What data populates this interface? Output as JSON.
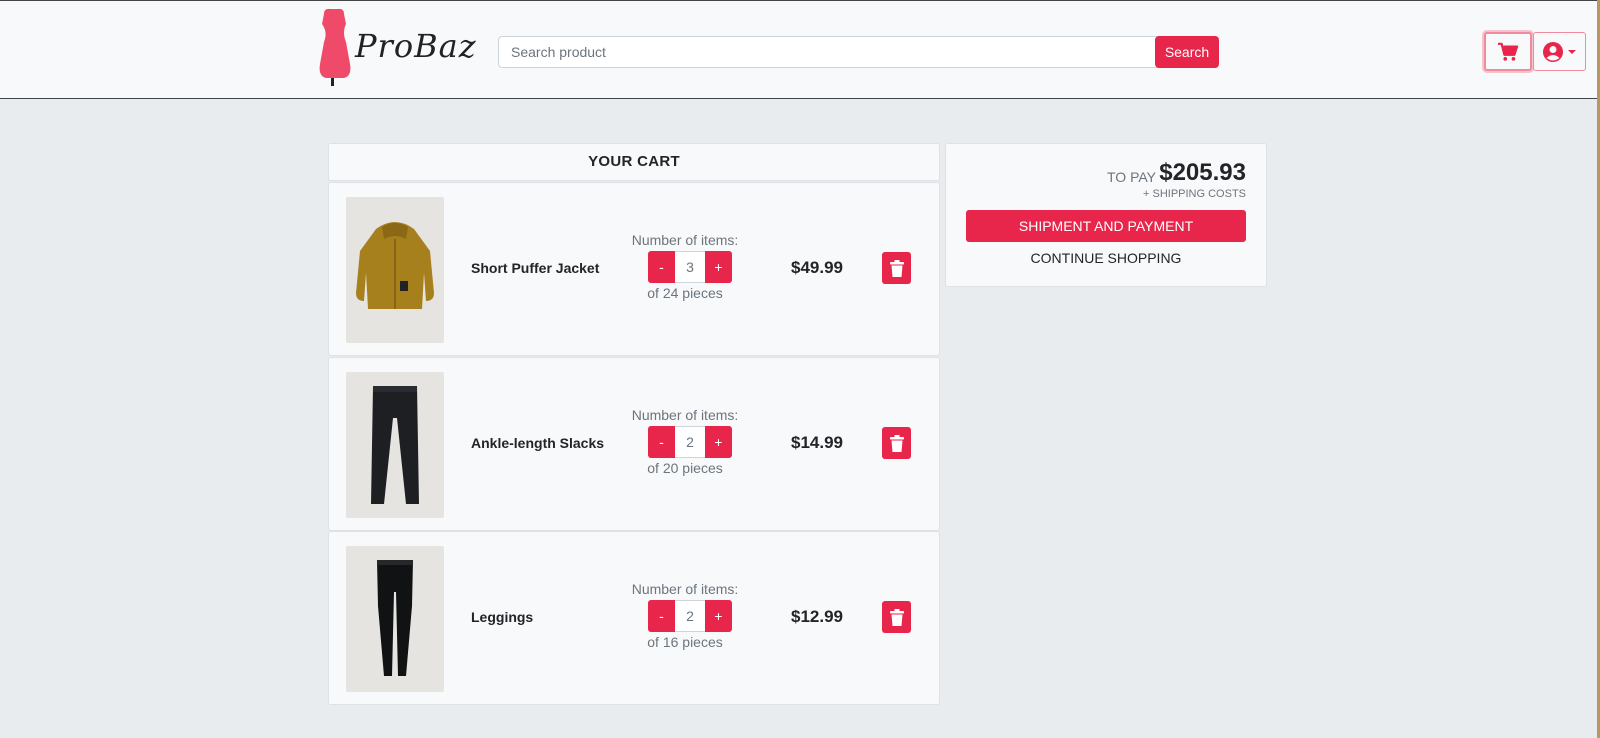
{
  "brand": {
    "name": "ProBaz",
    "accent_color": "#e8254a"
  },
  "header": {
    "search_placeholder": "Search product",
    "search_button": "Search",
    "cart_icon": "cart-icon",
    "user_icon": "user-circle-icon"
  },
  "cart": {
    "title": "YOUR CART",
    "qty_label": "Number of items:",
    "minus_label": "-",
    "plus_label": "+",
    "items": [
      {
        "name": "Short Puffer Jacket",
        "quantity": "3",
        "stock": "of 24 pieces",
        "price": "$49.99",
        "image": "jacket-image"
      },
      {
        "name": "Ankle-length Slacks",
        "quantity": "2",
        "stock": "of 20 pieces",
        "price": "$14.99",
        "image": "slacks-image"
      },
      {
        "name": "Leggings",
        "quantity": "2",
        "stock": "of 16 pieces",
        "price": "$12.99",
        "image": "leggings-image"
      }
    ]
  },
  "summary": {
    "to_pay_label": "TO PAY",
    "to_pay_value": "$205.93",
    "shipping_note": "+ SHIPPING COSTS",
    "pay_button": "SHIPMENT AND PAYMENT",
    "continue_link": "CONTINUE SHOPPING"
  }
}
